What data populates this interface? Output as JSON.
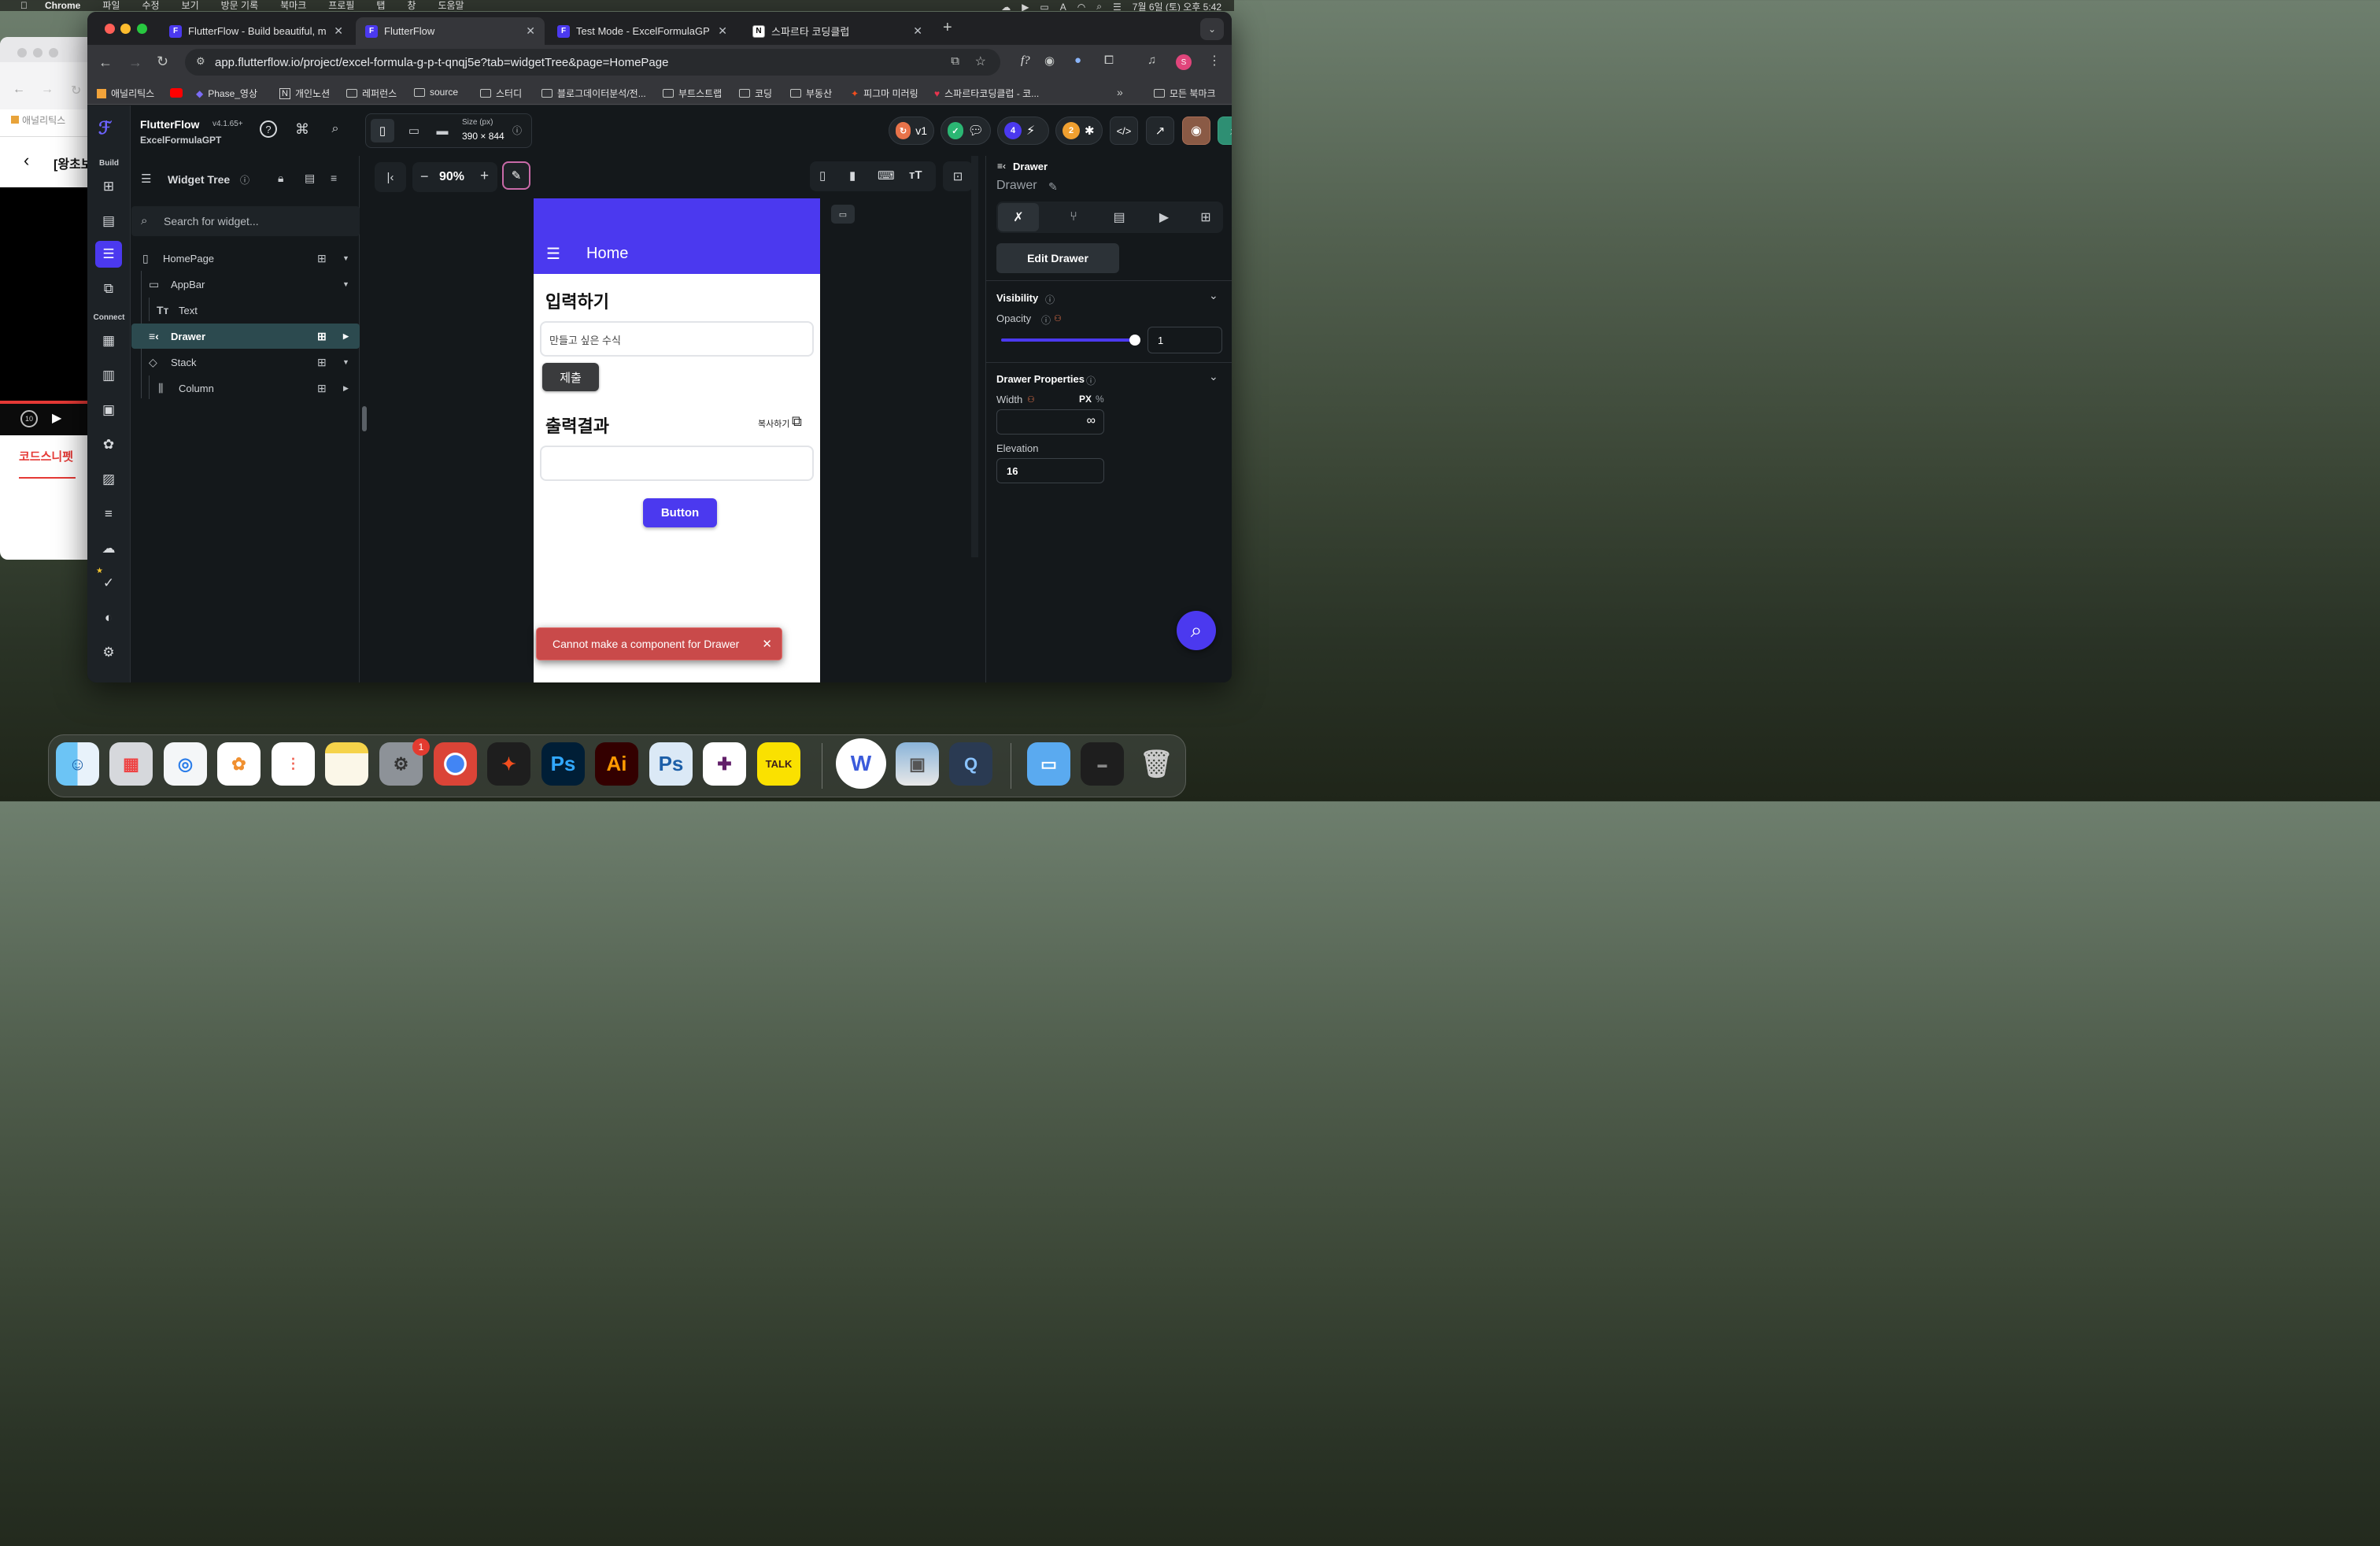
{
  "menubar": {
    "app": "Chrome",
    "items": [
      "파일",
      "수정",
      "보기",
      "방문 기록",
      "북마크",
      "프로필",
      "탭",
      "창",
      "도움말"
    ],
    "datetime": "7월 6일 (토) 오후 5:42",
    "input_indicator": "A"
  },
  "back_window": {
    "header_text": "[왕초보",
    "bookmark_label": "애널리틱스",
    "link_text": "코드스니펫",
    "replay_label": "10"
  },
  "tabs": [
    {
      "title": "FlutterFlow - Build beautiful, m",
      "favicon": "flutterflow-icon"
    },
    {
      "title": "FlutterFlow",
      "favicon": "flutterflow-icon"
    },
    {
      "title": "Test Mode - ExcelFormulaGPT",
      "favicon": "flutterflow-icon"
    },
    {
      "title": "스파르타 코딩클럽",
      "favicon": "notion-icon"
    }
  ],
  "url": "app.flutterflow.io/project/excel-formula-g-p-t-qnqj5e?tab=widgetTree&page=HomePage",
  "bookmarks": [
    "애널리틱스",
    "Phase_영상",
    "개인노션",
    "레퍼런스",
    "source",
    "스터디",
    "블로그데이터분석/전...",
    "부트스트랩",
    "코딩",
    "부동산",
    "피그마 미러링",
    "스파르타코딩클럽 - 코..."
  ],
  "bookmarks_all": "모든 북마크",
  "flutterflow": {
    "brand": "FlutterFlow",
    "version": "v4.1.65+",
    "project": "ExcelFormulaGPT",
    "size_label": "Size (px)",
    "size_value": "390 × 844",
    "version_tag": "v1",
    "badge_blue": "4",
    "badge_orange": "2",
    "rail_build": "Build",
    "rail_connect": "Connect"
  },
  "widget_tree": {
    "title": "Widget Tree",
    "search_placeholder": "Search for widget...",
    "rows": [
      {
        "label": "HomePage"
      },
      {
        "label": "AppBar"
      },
      {
        "label": "Text"
      },
      {
        "label": "Drawer"
      },
      {
        "label": "Stack"
      },
      {
        "label": "Column"
      }
    ]
  },
  "canvas": {
    "zoom": "90%",
    "minus": "−",
    "plus": "+"
  },
  "phone": {
    "appbar_title": "Home",
    "input_heading": "입력하기",
    "input_placeholder": "만들고 싶은 수식",
    "submit_label": "제출",
    "output_heading": "출력결과",
    "copy_label": "복사하기",
    "button_label": "Button"
  },
  "toast": {
    "message": "Cannot make a component for Drawer",
    "color": "#c94a4a"
  },
  "right_panel": {
    "widget_type": "Drawer",
    "widget_name": "Drawer",
    "edit_button": "Edit Drawer",
    "visibility": "Visibility",
    "opacity_label": "Opacity",
    "opacity_value": "1",
    "opacity_level": 1.0,
    "drawer_props": "Drawer Properties",
    "width_label": "Width",
    "unit_px": "PX",
    "unit_pct": "%",
    "width_value": "∞",
    "elevation_label": "Elevation",
    "elevation_value": "16"
  },
  "colors": {
    "accent": "#4b39ef",
    "selected_row": "#2c4a4f",
    "toast": "#c94a4a"
  },
  "dock": {
    "apps": [
      "finder",
      "launchpad",
      "safari",
      "photos",
      "reminders",
      "notes",
      "system-settings",
      "chrome",
      "figma",
      "photoshop",
      "illustrator",
      "photoshop-2",
      "slack",
      "kakaotalk",
      "w-app",
      "preview",
      "quicktime",
      "folder",
      "terminal-window",
      "trash"
    ],
    "settings_badge": "1",
    "ps_label": "Ps",
    "ai_label": "Ai",
    "talk_label": "TALK",
    "w_label": "W"
  }
}
